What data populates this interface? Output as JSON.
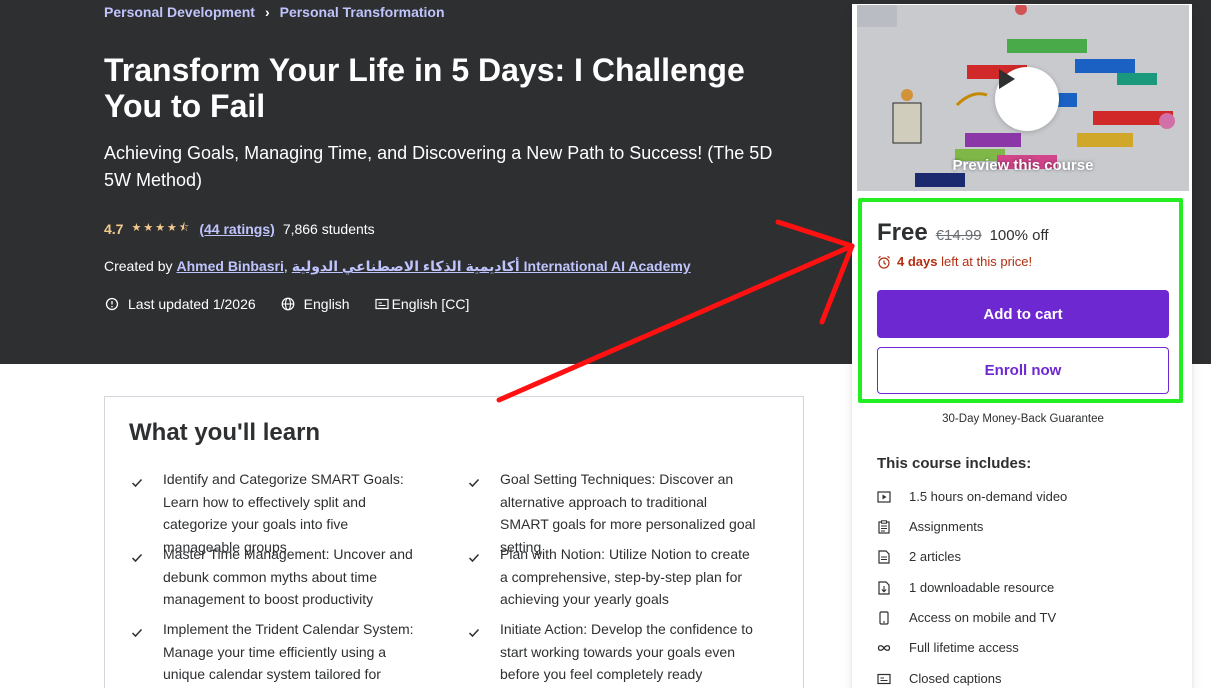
{
  "breadcrumb": {
    "items": [
      "Personal Development",
      "Personal Transformation"
    ],
    "separator": "›"
  },
  "course": {
    "title": "Transform Your Life in 5 Days: I Challenge You to Fail",
    "subtitle": "Achieving Goals, Managing Time, and Discovering a New Path to Success! (The 5D 5W Method)",
    "rating": "4.7",
    "stars": "★★★★⯪",
    "ratings_link": "(44 ratings)",
    "students": "7,866 students",
    "created_by_label": "Created by",
    "author_1": "Ahmed Binbasri",
    "author_sep": ",",
    "author_2": "أكاديمية الذكاء الاصطناعي الدولية International AI Academy",
    "last_updated": "Last updated 1/2026",
    "language": "English",
    "captions": "English [CC]"
  },
  "learn": {
    "title": "What you'll learn",
    "items": [
      "Identify and Categorize SMART Goals: Learn how to effectively split and categorize your goals into five manageable groups",
      "Goal Setting Techniques: Discover an alternative approach to traditional SMART goals for more personalized goal setting",
      "Master Time Management: Uncover and debunk common myths about time management to boost productivity",
      "Plan with Notion: Utilize Notion to create a comprehensive, step-by-step plan for achieving your yearly goals",
      "Implement the Trident Calendar System: Manage your time efficiently using a unique calendar system tailored for success",
      "Initiate Action: Develop the confidence to start working towards your goals even before you feel completely ready"
    ]
  },
  "sidebar": {
    "preview_label": "Preview this course",
    "price_free": "Free",
    "price_old": "€14.99",
    "price_off": "100% off",
    "time_left_bold": "4 days",
    "time_left_rest": "left at this price!",
    "add_to_cart": "Add to cart",
    "enroll_now": "Enroll now",
    "guarantee": "30-Day Money-Back Guarantee",
    "includes_title": "This course includes:",
    "includes": [
      "1.5 hours on-demand video",
      "Assignments",
      "2 articles",
      "1 downloadable resource",
      "Access on mobile and TV",
      "Full lifetime access",
      "Closed captions"
    ]
  },
  "colors": {
    "hero_bg": "#2d2f31",
    "link_purple": "#c0c4fc",
    "star_gold": "#f3ca8c",
    "brand_purple": "#6d28d2",
    "alert_red": "#b32d0f",
    "highlight_green": "#22ee22",
    "annotation_red": "#ff1111"
  }
}
